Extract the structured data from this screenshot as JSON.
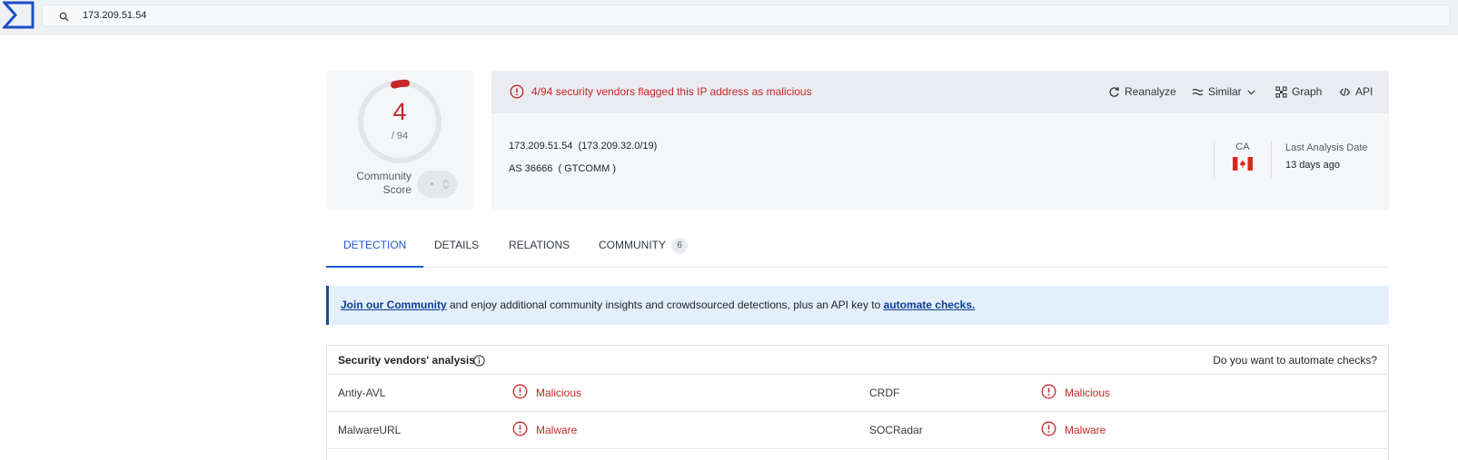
{
  "search": {
    "value": "173.209.51.54"
  },
  "score": {
    "positives": "4",
    "total": "/ 94",
    "community_label": "Community Score"
  },
  "alert": {
    "text": "4/94 security vendors flagged this IP address as malicious"
  },
  "actions": [
    {
      "label": "Reanalyze",
      "icon": "reanalyze-icon"
    },
    {
      "label": "Similar",
      "icon": "similar-icon"
    },
    {
      "label": "Graph",
      "icon": "graph-icon"
    },
    {
      "label": "API",
      "icon": "api-icon"
    }
  ],
  "ip": {
    "address": "173.209.51.54",
    "range": "(173.209.32.0/19)",
    "as_number": "AS 36666",
    "as_owner": "( GTCOMM )"
  },
  "country": {
    "code": "CA"
  },
  "analysis": {
    "label": "Last Analysis Date",
    "value": "13 days ago"
  },
  "tabs": [
    {
      "label": "DETECTION"
    },
    {
      "label": "DETAILS"
    },
    {
      "label": "RELATIONS"
    },
    {
      "label": "COMMUNITY",
      "badge": "6"
    }
  ],
  "banner": {
    "link1": "Join our Community",
    "middle": " and enjoy additional community insights and crowdsourced detections, plus an API key to ",
    "link2": "automate checks."
  },
  "vendors": {
    "title": "Security vendors' analysis",
    "automate_question": "Do you want to automate checks?",
    "rows": [
      {
        "left_name": "Antiy-AVL",
        "left_result": "Malicious",
        "right_name": "CRDF",
        "right_result": "Malicious"
      },
      {
        "left_name": "MalwareURL",
        "left_result": "Malware",
        "right_name": "SOCRadar",
        "right_result": "Malware"
      }
    ]
  },
  "colors": {
    "accent": "#1f5ad1",
    "malicious": "#c62828",
    "banner_bg": "#e3f0fc"
  }
}
